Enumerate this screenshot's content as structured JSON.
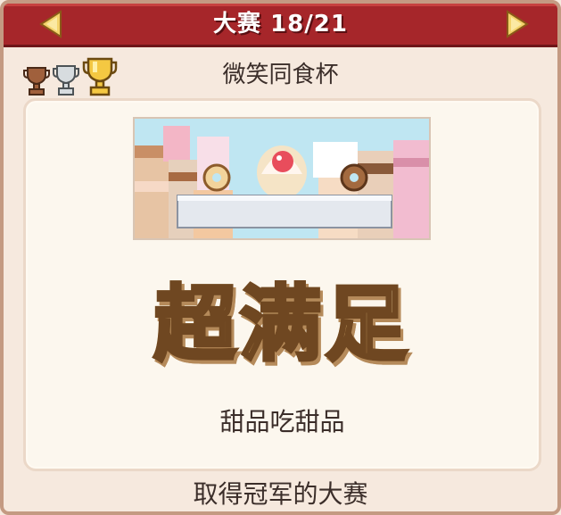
{
  "header": {
    "title": "大赛 18/21"
  },
  "trophies": [
    "bronze-trophy",
    "silver-trophy",
    "gold-trophy"
  ],
  "cup": {
    "name": "微笑同食杯"
  },
  "result": {
    "rating": "超满足",
    "description": "甜品吃甜品"
  },
  "footer": {
    "text": "取得冠军的大赛"
  },
  "colors": {
    "header": "#a6262a",
    "background": "#f6e9de",
    "panel": "#fcf7ee",
    "arrow": "#f3d36b",
    "gold": "#f4c842"
  }
}
